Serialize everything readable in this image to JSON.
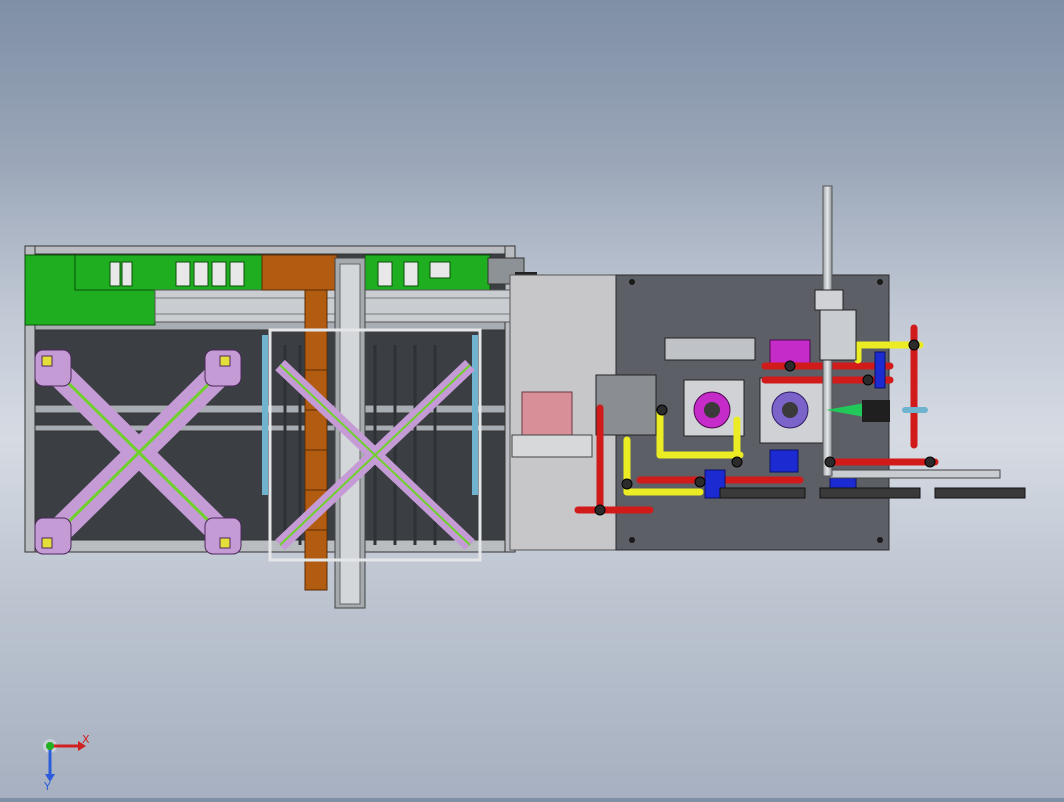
{
  "viewport": {
    "background_top": "#7f8fa6",
    "background_bottom": "#a6b0c0"
  },
  "colors": {
    "frame": "#5f6366",
    "frame_light": "#b9bdc2",
    "pcb_green": "#1fae1f",
    "orange_chain": "#b25c12",
    "lilac": "#c59bd6",
    "plate_light": "#c7c7c9",
    "plate_dark": "#5d5f66",
    "red_rod": "#d11a1a",
    "yellow_rod": "#ecec24",
    "blue_part": "#1c2ad1",
    "magenta": "#c52bc9",
    "cyan_rail": "#6fb3cf",
    "pink_block": "#d98f98"
  },
  "triad": {
    "x_label": "X",
    "y_label": "Y",
    "x_color": "#d12020",
    "y_color": "#2a5cdc"
  }
}
